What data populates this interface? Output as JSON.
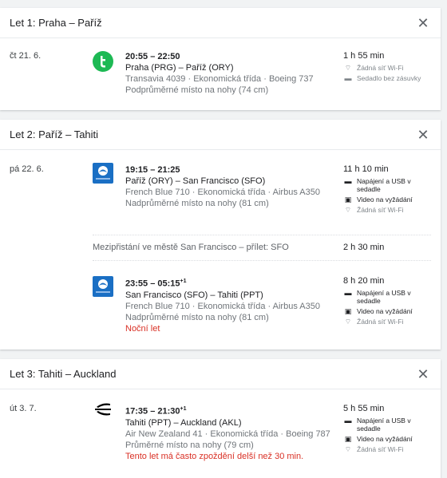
{
  "legs": [
    {
      "title": "Let 1: Praha – Paříž",
      "segments": [
        {
          "date": "čt 21. 6.",
          "times": "20:55 – 22:50",
          "times_suffix": "",
          "route": "Praha (PRG) – Paříž (ORY)",
          "meta": "Transavia 4039 · Ekonomická třída · Boeing 737",
          "legroom": "Podprůměrné místo na nohy (74 cm)",
          "note": "",
          "duration": "1 h 55 min",
          "amenities": [
            "Žádná síť Wi-Fi",
            "Sedadlo bez zásuvky"
          ],
          "logo": "transavia-logo"
        }
      ]
    },
    {
      "title": "Let 2: Paříž – Tahiti",
      "segments": [
        {
          "date": "pá 22. 6.",
          "times": "19:15 – 21:25",
          "times_suffix": "",
          "route": "Paříž (ORY) – San Francisco (SFO)",
          "meta": "French Blue 710 · Ekonomická třída · Airbus A350",
          "legroom": "Nadprůměrné místo na nohy (81 cm)",
          "note": "",
          "duration": "11 h 10 min",
          "amenities": [
            "Napájení a USB v sedadle",
            "Video na vyžádání",
            "Žádná síť Wi-Fi"
          ],
          "logo": "frenchblue-logo"
        },
        {
          "date": "",
          "times": "23:55 – 05:15",
          "times_suffix": "+1",
          "route": "San Francisco (SFO) – Tahiti (PPT)",
          "meta": "French Blue 710 · Ekonomická třída · Airbus A350",
          "legroom": "Nadprůměrné místo na nohy (81 cm)",
          "note": "Noční let",
          "duration": "8 h 20 min",
          "amenities": [
            "Napájení a USB v sedadle",
            "Video na vyžádání",
            "Žádná síť Wi-Fi"
          ],
          "logo": "frenchblue-logo"
        }
      ],
      "layover": {
        "text": "Mezipřistání ve městě San Francisco – přílet: SFO",
        "duration": "2 h 30 min"
      }
    },
    {
      "title": "Let 3: Tahiti – Auckland",
      "segments": [
        {
          "date": "út 3. 7.",
          "times": "17:35 – 21:30",
          "times_suffix": "+1",
          "route": "Tahiti (PPT) – Auckland (AKL)",
          "meta": "Air New Zealand 41 · Ekonomická třída · Boeing 787",
          "legroom": "Průměrné místo na nohy (79 cm)",
          "note": "Tento let má často zpoždění delší než 30 min.",
          "duration": "5 h 55 min",
          "amenities": [
            "Napájení a USB v sedadle",
            "Video na vyžádání",
            "Žádná síť Wi-Fi"
          ],
          "logo": "airnewzealand-logo"
        }
      ]
    }
  ],
  "close_label": "✕",
  "colors": {
    "transavia": "#1db954",
    "frenchblue": "#1a6fc4",
    "note_red": "#d93025"
  }
}
